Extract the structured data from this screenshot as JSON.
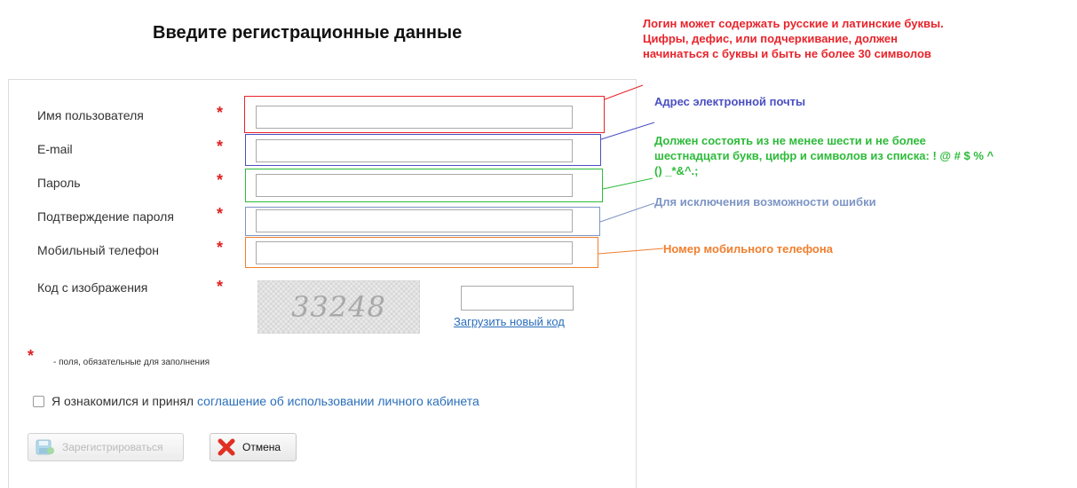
{
  "title": "Введите регистрационные данные",
  "form": {
    "fields": [
      {
        "label": "Имя пользователя",
        "value": ""
      },
      {
        "label": "E-mail",
        "value": ""
      },
      {
        "label": "Пароль",
        "value": ""
      },
      {
        "label": "Подтверждение пароля",
        "value": ""
      },
      {
        "label": "Мобильный телефон",
        "value": ""
      }
    ],
    "captcha": {
      "label": "Код с изображения",
      "image_text": "33248",
      "value": "",
      "reload_link": "Загрузить новый код"
    },
    "required_marker": "*",
    "required_note": "- поля, обязательные для заполнения",
    "agreement": {
      "text": "Я ознакомился и принял",
      "link": "соглашение об использовании личного кабинета",
      "checked": false
    },
    "register_button": "Зарегистрироваться",
    "cancel_button": "Отмена"
  },
  "annotations": {
    "login": {
      "lines": [
        "Логин может содержать русские и латинские буквы.",
        "Цифры, дефис, или подчеркивание, должен",
        "начинаться с буквы и быть не более 30 символов"
      ],
      "color": "#e8242b"
    },
    "email": {
      "text": "Адрес электронной почты",
      "color": "#4a4fc2"
    },
    "password": {
      "lines": [
        "Должен состоять из не менее шести и не более",
        "шестнадцати букв, цифр и символов из списка: ! @ # $ % ^",
        "() _*&^.;"
      ],
      "color": "#2dbb3a"
    },
    "confirm": {
      "text": "Для исключения возможности ошибки",
      "color": "#7d95c4"
    },
    "phone": {
      "text": "Номер мобильного телефона",
      "color": "#f07f2e"
    }
  }
}
